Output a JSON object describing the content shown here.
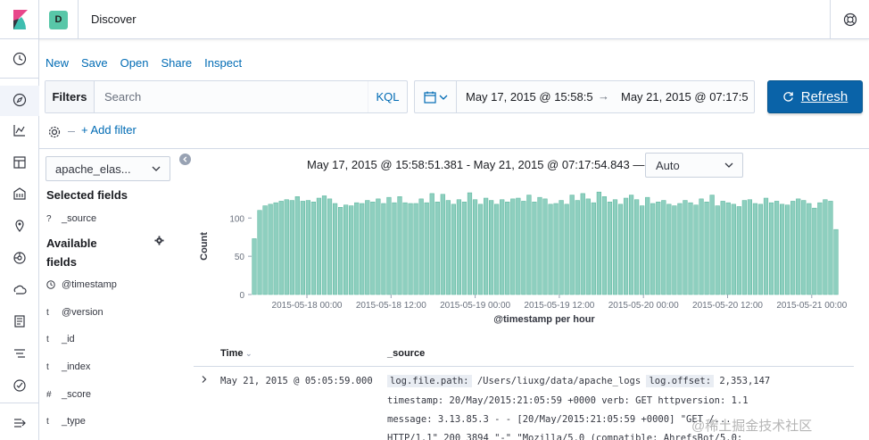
{
  "header": {
    "space_initial": "D",
    "app_title": "Discover"
  },
  "top_menu": [
    "New",
    "Save",
    "Open",
    "Share",
    "Inspect"
  ],
  "query_bar": {
    "filters_label": "Filters",
    "search_placeholder": "Search",
    "language_label": "KQL"
  },
  "date_picker": {
    "start": "May 17, 2015 @ 15:58:5",
    "arrow": "→",
    "end": "May 21, 2015 @ 07:17:5"
  },
  "refresh_label": "Refresh",
  "add_filter_label": "+ Add filter",
  "sidebar": {
    "index_pattern": "apache_elas...",
    "selected_title": "Selected fields",
    "selected_fields": [
      {
        "type": "?",
        "name": "_source"
      }
    ],
    "available_title_1": "Available",
    "available_title_2": "fields",
    "available_fields": [
      {
        "type": "clock",
        "name": "@timestamp"
      },
      {
        "type": "t",
        "name": "@version"
      },
      {
        "type": "t",
        "name": "_id"
      },
      {
        "type": "t",
        "name": "_index"
      },
      {
        "type": "#",
        "name": "_score"
      },
      {
        "type": "t",
        "name": "_type"
      }
    ]
  },
  "chart_header": {
    "range": "May 17, 2015 @ 15:58:51.381 - May 21, 2015 @ 07:17:54.843 —",
    "interval": "Auto"
  },
  "chart_data": {
    "type": "bar",
    "title": "",
    "ylabel": "Count",
    "xlabel": "@timestamp per hour",
    "ylim": [
      0,
      140
    ],
    "yticks": [
      0,
      50,
      100
    ],
    "x_ticks": [
      "2015-05-18 00:00",
      "2015-05-18 12:00",
      "2015-05-19 00:00",
      "2015-05-19 12:00",
      "2015-05-20 00:00",
      "2015-05-20 12:00",
      "2015-05-21 00:00"
    ],
    "bar_color": "#8ecfbf",
    "bar_edge": "#54b399",
    "values": [
      73,
      110,
      116,
      118,
      120,
      122,
      124,
      123,
      128,
      122,
      123,
      121,
      126,
      129,
      125,
      119,
      114,
      117,
      116,
      120,
      119,
      123,
      121,
      125,
      119,
      127,
      120,
      128,
      120,
      119,
      119,
      125,
      120,
      132,
      121,
      131,
      123,
      118,
      124,
      121,
      133,
      124,
      118,
      126,
      123,
      118,
      124,
      121,
      125,
      126,
      122,
      130,
      121,
      127,
      125,
      118,
      119,
      123,
      118,
      130,
      123,
      132,
      125,
      120,
      134,
      128,
      121,
      124,
      118,
      126,
      130,
      124,
      116,
      127,
      119,
      121,
      123,
      118,
      116,
      119,
      123,
      120,
      117,
      125,
      121,
      130,
      116,
      122,
      120,
      118,
      115,
      123,
      124,
      119,
      118,
      126,
      120,
      122,
      118,
      117,
      122,
      125,
      123,
      119,
      113,
      120,
      124,
      122,
      85
    ]
  },
  "table": {
    "col_time": "Time",
    "col_source": "_source",
    "row_time": "May 21, 2015 @ 05:05:59.000",
    "src_line1_k1": "log.file.path:",
    "src_line1_v1": " /Users/liuxg/data/apache_logs ",
    "src_line1_k2": "log.offset:",
    "src_line1_v2": " 2,353,147",
    "src_line2": "timestamp: 20/May/2015:21:05:59 +0000  verb: GET  httpversion: 1.1",
    "src_line3": "message: 3.13.85.3 - - [20/May/2015:21:05:59 +0000] \"GET /...",
    "src_line4": "HTTP/1.1\" 200 3894 \"-\" \"Mozilla/5.0 (compatible; AhrefsBot/5.0;"
  },
  "watermark": "@稀土掘金技术社区"
}
